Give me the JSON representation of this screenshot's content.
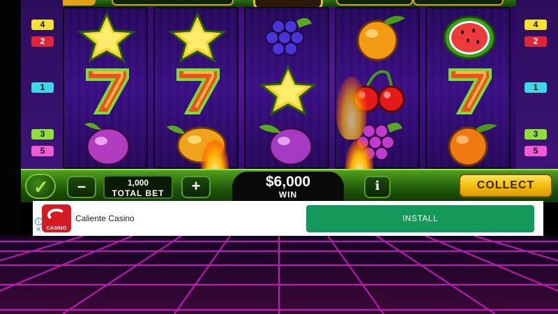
{
  "paylines": {
    "left": [
      "4",
      "2",
      "1",
      "3",
      "5"
    ],
    "right": [
      "4",
      "2",
      "1",
      "3",
      "5"
    ]
  },
  "reels": [
    [
      "star-icon",
      "seven-icon",
      "plum-icon"
    ],
    [
      "star-icon",
      "seven-icon",
      "lemon-icon"
    ],
    [
      "grapes-icon",
      "star-icon",
      "plum-icon"
    ],
    [
      "orange-icon",
      "cherry-icon",
      "grapes-icon"
    ],
    [
      "watermelon-icon",
      "seven-icon",
      "orange-icon"
    ]
  ],
  "controls": {
    "minus": "–",
    "plus": "+",
    "total_bet_value": "1,000",
    "total_bet_label": "TOTAL BET",
    "win_value": "$6,000",
    "win_label": "WIN",
    "info": "i",
    "collect": "COLLECT",
    "check": "✓"
  },
  "ad": {
    "app_name": "Caliente Casino",
    "logo_text": "CASINO",
    "install": "INSTALL",
    "info_icon": "i",
    "close_icon": "✕",
    "brand_color": "#d51a22",
    "button_color": "#14985a"
  },
  "colors": {
    "reel_bg": "#3a0f84",
    "grid_line": "#e21ad4"
  }
}
